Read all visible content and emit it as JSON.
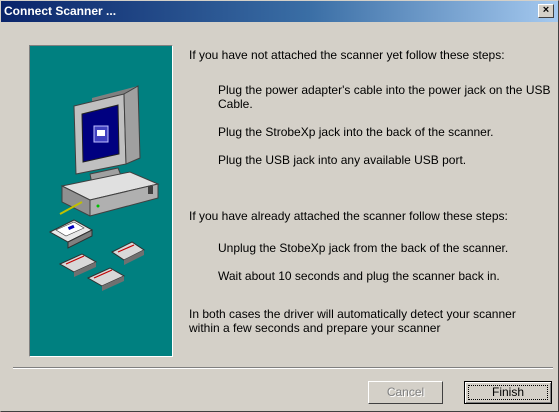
{
  "window": {
    "title": "Connect Scanner ...",
    "close_glyph": "×"
  },
  "illustration": {
    "icon": "computer-with-scanner-icon",
    "background_color": "#008080"
  },
  "instructions": {
    "not_attached_intro": "If you have not attached the scanner yet follow these steps:",
    "not_attached_steps": [
      "Plug the power adapter's cable into the power jack on the USB Cable.",
      "Plug the StrobeXp jack into the back of the scanner.",
      "Plug the USB jack into any available USB port."
    ],
    "attached_intro": "If you have already attached the scanner follow these steps:",
    "attached_steps": [
      "Unplug the StobeXp jack from the back of the scanner.",
      "Wait about 10 seconds and plug the scanner back in."
    ],
    "closing": "In both cases the driver will automatically detect your scanner within a few seconds and prepare your scanner"
  },
  "buttons": {
    "cancel_label": "Cancel",
    "finish_label": "Finish"
  }
}
